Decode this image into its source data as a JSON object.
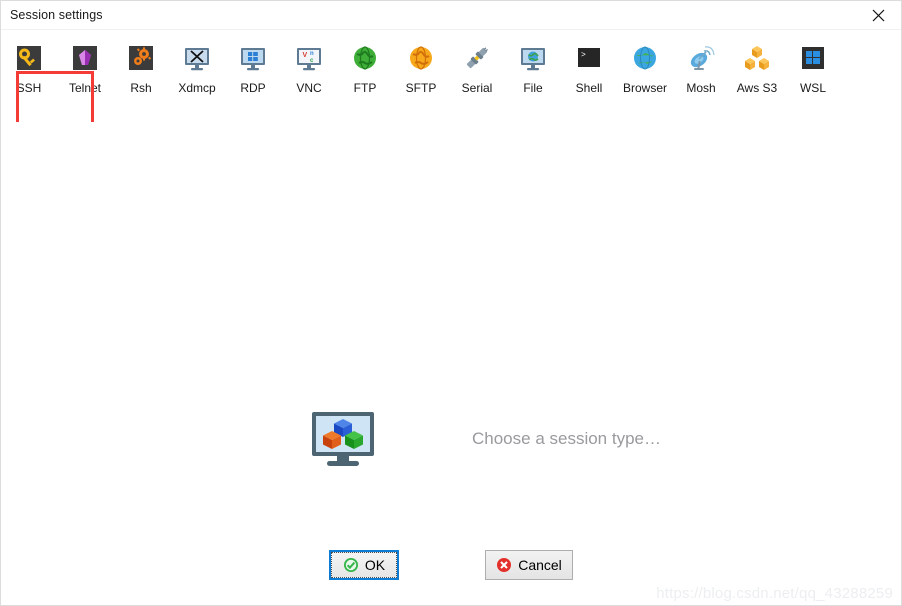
{
  "window": {
    "title": "Session settings",
    "close_icon": "close-icon"
  },
  "toolbar": {
    "selected": "SSH",
    "highlight_color": "#f43b36",
    "items": [
      {
        "label": "SSH",
        "icon": "key-icon"
      },
      {
        "label": "Telnet",
        "icon": "gem-icon"
      },
      {
        "label": "Rsh",
        "icon": "gears-icon"
      },
      {
        "label": "Xdmcp",
        "icon": "monitor-x-icon"
      },
      {
        "label": "RDP",
        "icon": "monitor-windows-icon"
      },
      {
        "label": "VNC",
        "icon": "monitor-vnc-icon"
      },
      {
        "label": "FTP",
        "icon": "green-globe-icon"
      },
      {
        "label": "SFTP",
        "icon": "orange-globe-icon"
      },
      {
        "label": "Serial",
        "icon": "serial-plug-icon"
      },
      {
        "label": "File",
        "icon": "monitor-globe-icon"
      },
      {
        "label": "Shell",
        "icon": "terminal-icon"
      },
      {
        "label": "Browser",
        "icon": "blue-globe-icon"
      },
      {
        "label": "Mosh",
        "icon": "satellite-dish-icon"
      },
      {
        "label": "Aws S3",
        "icon": "aws-cubes-icon"
      },
      {
        "label": "WSL",
        "icon": "windows-box-icon"
      }
    ]
  },
  "main": {
    "placeholder_text": "Choose a session type…",
    "placeholder_icon": "monitor-cubes-icon"
  },
  "buttons": {
    "ok": {
      "label": "OK",
      "icon": "green-check-icon",
      "focused": true
    },
    "cancel": {
      "label": "Cancel",
      "icon": "red-x-icon",
      "focused": false
    }
  },
  "watermark": {
    "text": "https://blog.csdn.net/qq_43288259"
  },
  "colors": {
    "accent_blue": "#0c7cd5",
    "highlight_red": "#f43b36",
    "ok_green": "#35b64a",
    "cancel_red": "#e3302a",
    "placeholder_gray": "#9a9a9e",
    "watermark_gray": "#eceef0"
  }
}
